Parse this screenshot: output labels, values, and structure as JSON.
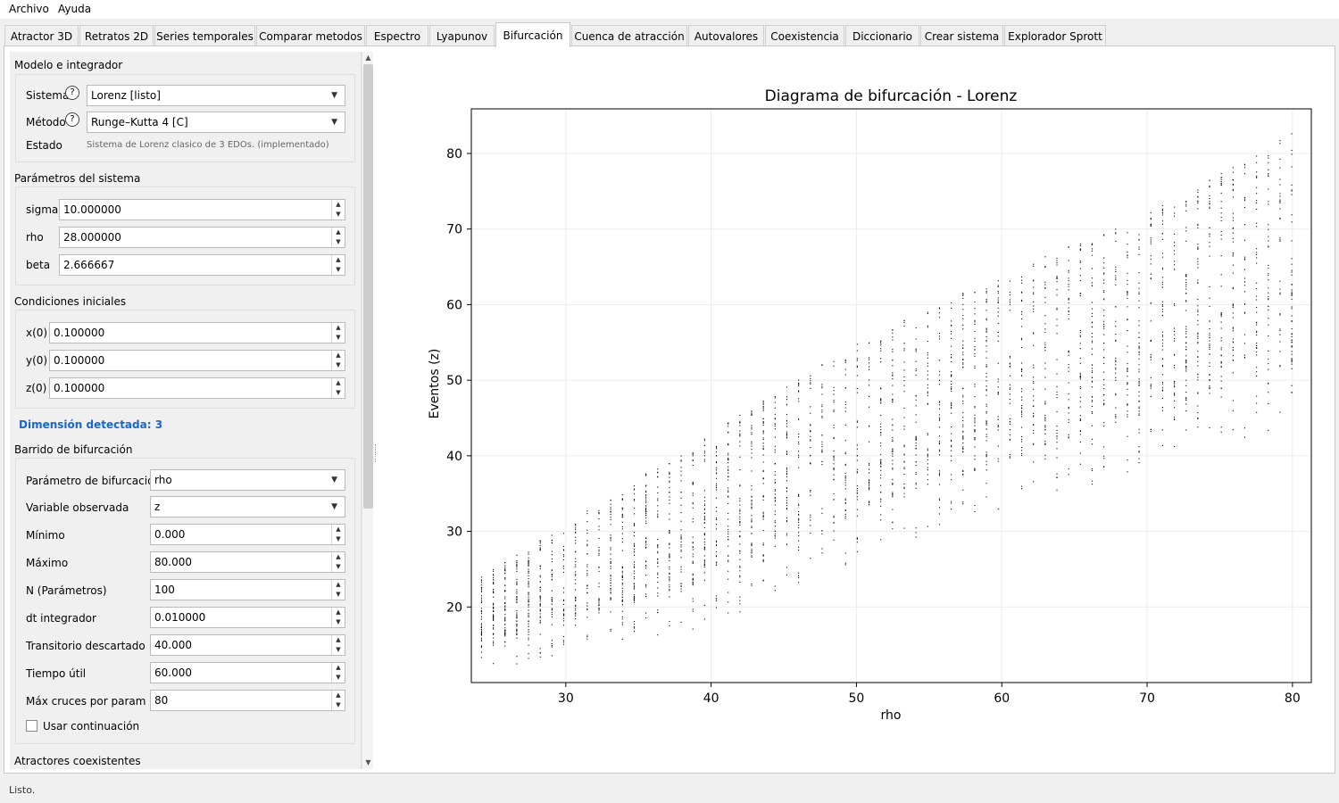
{
  "menu": {
    "items": [
      "Archivo",
      "Ayuda"
    ]
  },
  "tabs": {
    "items": [
      "Atractor 3D",
      "Retratos 2D",
      "Series temporales",
      "Comparar metodos",
      "Espectro",
      "Lyapunov",
      "Bifurcación",
      "Cuenca de atracción",
      "Autovalores",
      "Coexistencia",
      "Diccionario",
      "Crear sistema",
      "Explorador Sprott"
    ],
    "active": "Bifurcación"
  },
  "model": {
    "title": "Modelo e integrador",
    "system_label": "Sistema",
    "system_value": "Lorenz [listo]",
    "method_label": "Método",
    "method_value": "Runge–Kutta 4 [C]",
    "state_label": "Estado",
    "state_value": "Sistema de Lorenz clasico de 3 EDOs. (implementado)",
    "help_glyph": "?"
  },
  "params": {
    "title": "Parámetros del sistema",
    "items": [
      {
        "label": "sigma",
        "value": "10.000000"
      },
      {
        "label": "rho",
        "value": "28.000000"
      },
      {
        "label": "beta",
        "value": "2.666667"
      }
    ]
  },
  "initial": {
    "title": "Condiciones iniciales",
    "items": [
      {
        "label": "x(0)",
        "value": "0.100000"
      },
      {
        "label": "y(0)",
        "value": "0.100000"
      },
      {
        "label": "z(0)",
        "value": "0.100000"
      }
    ]
  },
  "dimension_text": "Dimensión detectada: 3",
  "sweep": {
    "title": "Barrido de bifurcación",
    "param_label": "Parámetro de bifurcación",
    "param_value": "rho",
    "var_label": "Variable observada",
    "var_value": "z",
    "fields": [
      {
        "label": "Mínimo",
        "value": "0.000"
      },
      {
        "label": "Máximo",
        "value": "80.000"
      },
      {
        "label": "N (Parámetros)",
        "value": "100"
      },
      {
        "label": "dt integrador",
        "value": "0.010000"
      },
      {
        "label": "Transitorio descartado",
        "value": "40.000"
      },
      {
        "label": "Tiempo útil",
        "value": "60.000"
      },
      {
        "label": "Máx cruces por param",
        "value": "80"
      }
    ],
    "continuation_label": "Usar continuación"
  },
  "coexist_title": "Atractores coexistentes",
  "status": "Listo.",
  "chart_data": {
    "type": "scatter",
    "title": "Diagrama de bifurcación - Lorenz",
    "xlabel": "rho",
    "ylabel": "Eventos (z)",
    "xlim": [
      23.5,
      81.3
    ],
    "ylim": [
      10,
      85.9
    ],
    "xticks": [
      30,
      40,
      50,
      60,
      70,
      80
    ],
    "yticks": [
      20,
      30,
      40,
      50,
      60,
      70,
      80
    ],
    "grid": true,
    "marker_color": "#000000",
    "param_start": 24.2,
    "param_step": 0.808,
    "param_count": 70,
    "band_lower": [
      [
        24.2,
        13
      ],
      [
        30,
        16
      ],
      [
        40,
        20
      ],
      [
        50,
        28
      ],
      [
        60,
        35
      ],
      [
        70,
        41
      ],
      [
        80,
        46
      ]
    ],
    "band_upper": [
      [
        24.2,
        24
      ],
      [
        30,
        31
      ],
      [
        40,
        43
      ],
      [
        50,
        55
      ],
      [
        60,
        64
      ],
      [
        70,
        72
      ],
      [
        80,
        83
      ]
    ]
  }
}
